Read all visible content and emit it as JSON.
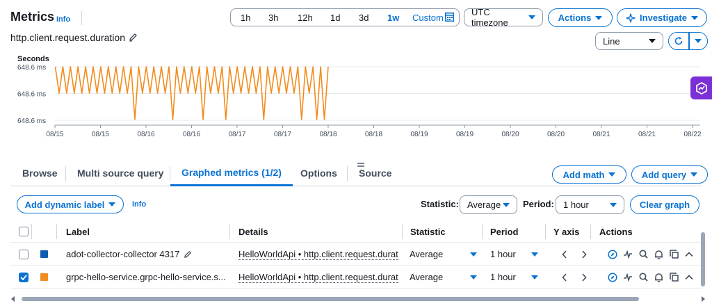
{
  "header": {
    "title": "Metrics",
    "info": "Info",
    "time_ranges": [
      "1h",
      "3h",
      "12h",
      "1d",
      "3d",
      "1w"
    ],
    "active_range": "1w",
    "custom_label": "Custom",
    "timezone": "UTC timezone",
    "actions_label": "Actions",
    "investigate_label": "Investigate"
  },
  "graph": {
    "name": "http.client.request.duration",
    "view_type": "Line"
  },
  "chart_data": {
    "type": "line",
    "ylabel": "Seconds",
    "y_ticks": [
      "648.6 ms",
      "648.6 ms",
      "648.6 ms"
    ],
    "x_ticks": [
      "08/15",
      "08/15",
      "08/16",
      "08/16",
      "08/17",
      "08/17",
      "08/18",
      "08/18",
      "08/19",
      "08/19",
      "08/20",
      "08/20",
      "08/21",
      "08/21",
      "08/22"
    ],
    "grid": true,
    "series": [
      {
        "color": "#f28c1d",
        "values": [
          1,
          0.5,
          1,
          0.5,
          1,
          0.5,
          1,
          0.5,
          1,
          0.5,
          1,
          0.5,
          1,
          0.5,
          1,
          0.5,
          1,
          0.5,
          1,
          0.5,
          1,
          0,
          1,
          0.5,
          1,
          0.5,
          1,
          0.5,
          1,
          0.5,
          1,
          0,
          1,
          0.5,
          1,
          0.5,
          1,
          0.5,
          1,
          0,
          1,
          0.5,
          1,
          0.5,
          1,
          0,
          1,
          0.5,
          1,
          0.5,
          1,
          0.5,
          1,
          0.5,
          1,
          0,
          1,
          0.5,
          1,
          0.5,
          1,
          0.5,
          1,
          0.5,
          1,
          0,
          1,
          0.5,
          1,
          0,
          1,
          0,
          1
        ]
      }
    ]
  },
  "tabs": [
    {
      "label": "Browse"
    },
    {
      "label": "Multi source query"
    },
    {
      "label": "Graphed metrics (1/2)"
    },
    {
      "label": "Options"
    },
    {
      "label": "Source"
    }
  ],
  "toolbar": {
    "add_math": "Add math",
    "add_query": "Add query",
    "add_dynamic_label": "Add dynamic label",
    "info": "Info",
    "statistic_label": "Statistic:",
    "statistic_value": "Average",
    "period_label": "Period:",
    "period_value": "1 hour",
    "clear_graph": "Clear graph"
  },
  "table": {
    "columns": [
      "Label",
      "Details",
      "Statistic",
      "Period",
      "Y axis",
      "Actions"
    ],
    "rows": [
      {
        "checked": false,
        "color": "#0b5fae",
        "label": "adot-collector-collector 4317",
        "details": "HelloWorldApi • http.client.request.durat",
        "statistic": "Average",
        "period": "1 hour"
      },
      {
        "checked": true,
        "color": "#f28c1d",
        "label": "grpc-hello-service.grpc-hello-service.s...",
        "details": "HelloWorldApi • http.client.request.durat",
        "statistic": "Average",
        "period": "1 hour"
      }
    ]
  }
}
